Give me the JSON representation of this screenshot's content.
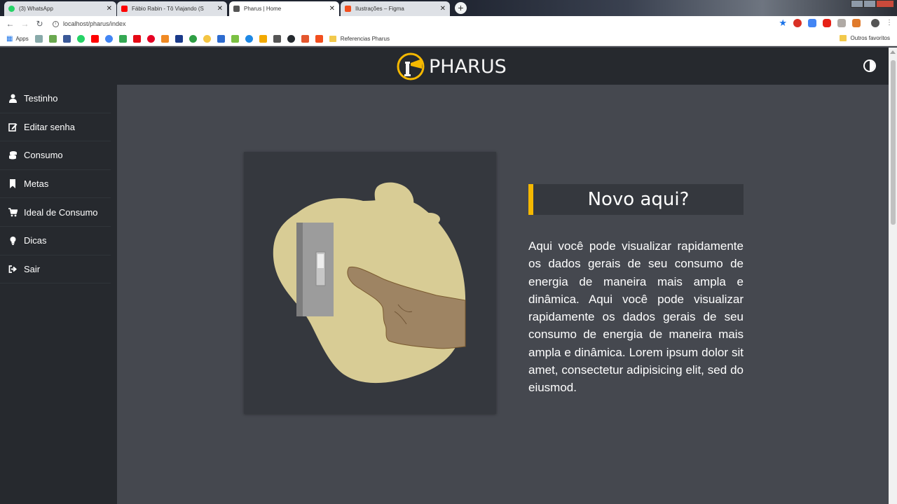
{
  "browser": {
    "tabs": [
      {
        "title": "(3) WhatsApp",
        "favicon_color": "#25d366",
        "active": false
      },
      {
        "title": "Fábio Rabin - Tô Viajando (S",
        "favicon_color": "#ff0000",
        "active": false
      },
      {
        "title": "Pharus | Home",
        "favicon_color": "#555555",
        "active": true
      },
      {
        "title": "Ilustrações – Figma",
        "favicon_color": "#f24e1e",
        "active": false
      }
    ],
    "close_glyph": "✕",
    "new_tab_glyph": "+",
    "url": "localhost/pharus/index",
    "info_glyph": "i",
    "bookmarks": {
      "apps_label": "Apps",
      "folder_label": "Referencias Pharus",
      "other_label": "Outros favoritos"
    }
  },
  "header": {
    "logo_text": "PHARUS",
    "theme_toggle_icon": "contrast-icon"
  },
  "sidebar": {
    "items": [
      {
        "label": "Testinho",
        "icon": "user-icon"
      },
      {
        "label": "Editar senha",
        "icon": "edit-icon"
      },
      {
        "label": "Consumo",
        "icon": "coins-icon"
      },
      {
        "label": "Metas",
        "icon": "bookmark-icon"
      },
      {
        "label": "Ideal de Consumo",
        "icon": "cart-icon"
      },
      {
        "label": "Dicas",
        "icon": "lightbulb-icon"
      },
      {
        "label": "Sair",
        "icon": "logout-icon"
      }
    ]
  },
  "main": {
    "heading": "Novo aqui?",
    "description": "Aqui você pode visualizar rapidamente os dados gerais de seu consumo de energia de maneira mais ampla e dinâmica. Aqui você pode visualizar rapidamente os dados gerais de seu consumo de energia de maneira mais ampla e dinâmica. Lorem ipsum dolor sit amet, consectetur adipisicing elit, sed do eiusmod.",
    "illustration": "hand-pressing-light-switch",
    "accent_color": "#f5b800",
    "blob_color": "#d8cc95"
  }
}
